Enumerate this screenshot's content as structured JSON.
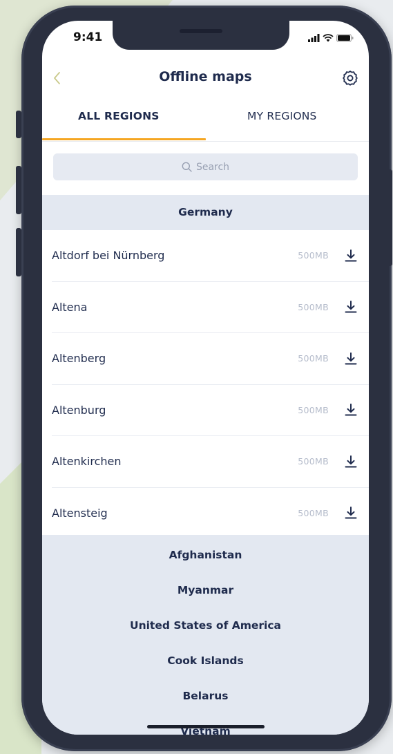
{
  "status_bar": {
    "time": "9:41"
  },
  "header": {
    "title": "Offline maps",
    "back_icon": "chevron-left-icon",
    "settings_icon": "gear-icon"
  },
  "tabs": [
    {
      "label": "ALL REGIONS",
      "active": true
    },
    {
      "label": "MY REGIONS",
      "active": false
    }
  ],
  "search": {
    "placeholder": "Search"
  },
  "sections": {
    "germany": {
      "title": "Germany",
      "items": [
        {
          "name": "Altdorf bei Nürnberg",
          "size": "500MB"
        },
        {
          "name": "Altena",
          "size": "500MB"
        },
        {
          "name": "Altenberg",
          "size": "500MB"
        },
        {
          "name": "Altenburg",
          "size": "500MB"
        },
        {
          "name": "Altenkirchen",
          "size": "500MB"
        },
        {
          "name": "Altensteig",
          "size": "500MB"
        }
      ]
    },
    "countries": [
      "Afghanistan",
      "Myanmar",
      "United States of America",
      "Cook Islands",
      "Belarus",
      "Vietnam"
    ]
  },
  "colors": {
    "accent": "#f5a623",
    "text": "#1f2b4d",
    "section_bg": "#e3e8f1",
    "muted": "#b5bccb"
  }
}
